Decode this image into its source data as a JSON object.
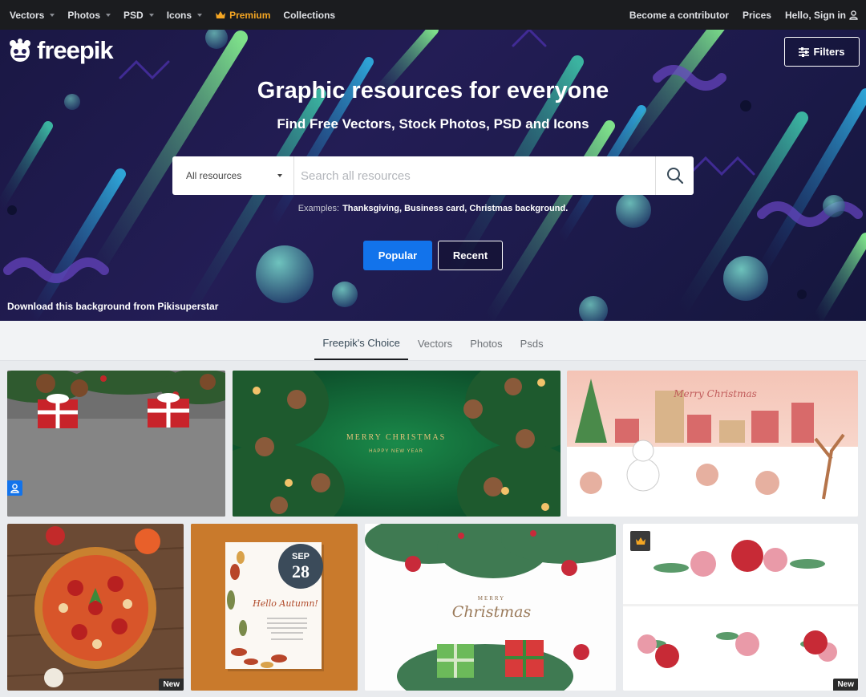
{
  "topnav": {
    "left": [
      {
        "label": "Vectors",
        "caret": true
      },
      {
        "label": "Photos",
        "caret": true
      },
      {
        "label": "PSD",
        "caret": true
      },
      {
        "label": "Icons",
        "caret": true
      }
    ],
    "premium": "Premium",
    "collections": "Collections",
    "contributor": "Become a contributor",
    "prices": "Prices",
    "signin": "Hello, Sign in"
  },
  "hero": {
    "logo": "freepik",
    "filters": "Filters",
    "title": "Graphic resources for everyone",
    "subtitle": "Find Free Vectors, Stock Photos, PSD and Icons",
    "search": {
      "selected": "All resources",
      "placeholder": "Search all resources"
    },
    "examples_label": "Examples:",
    "examples": "Thanksgiving, Business card, Christmas background.",
    "popular": "Popular",
    "recent": "Recent",
    "credit": "Download this background from Pikisuperstar"
  },
  "tabs": [
    "Freepik's Choice",
    "Vectors",
    "Photos",
    "Psds"
  ],
  "tiles": {
    "merry_christmas": "MERRY CHRISTMAS",
    "happy_new_year": "HAPPY NEW YEAR",
    "merry_christmas_script": "Merry Christmas",
    "sep": "SEP",
    "day": "28",
    "hello_autumn": "Hello Autumn!",
    "merry_script_2": "MERRY",
    "christmas_script_2": "Christmas",
    "new_badge": "New"
  },
  "colors": {
    "accent": "#1273eb",
    "premium": "#f5a623",
    "topbar": "#1b1c1f"
  }
}
